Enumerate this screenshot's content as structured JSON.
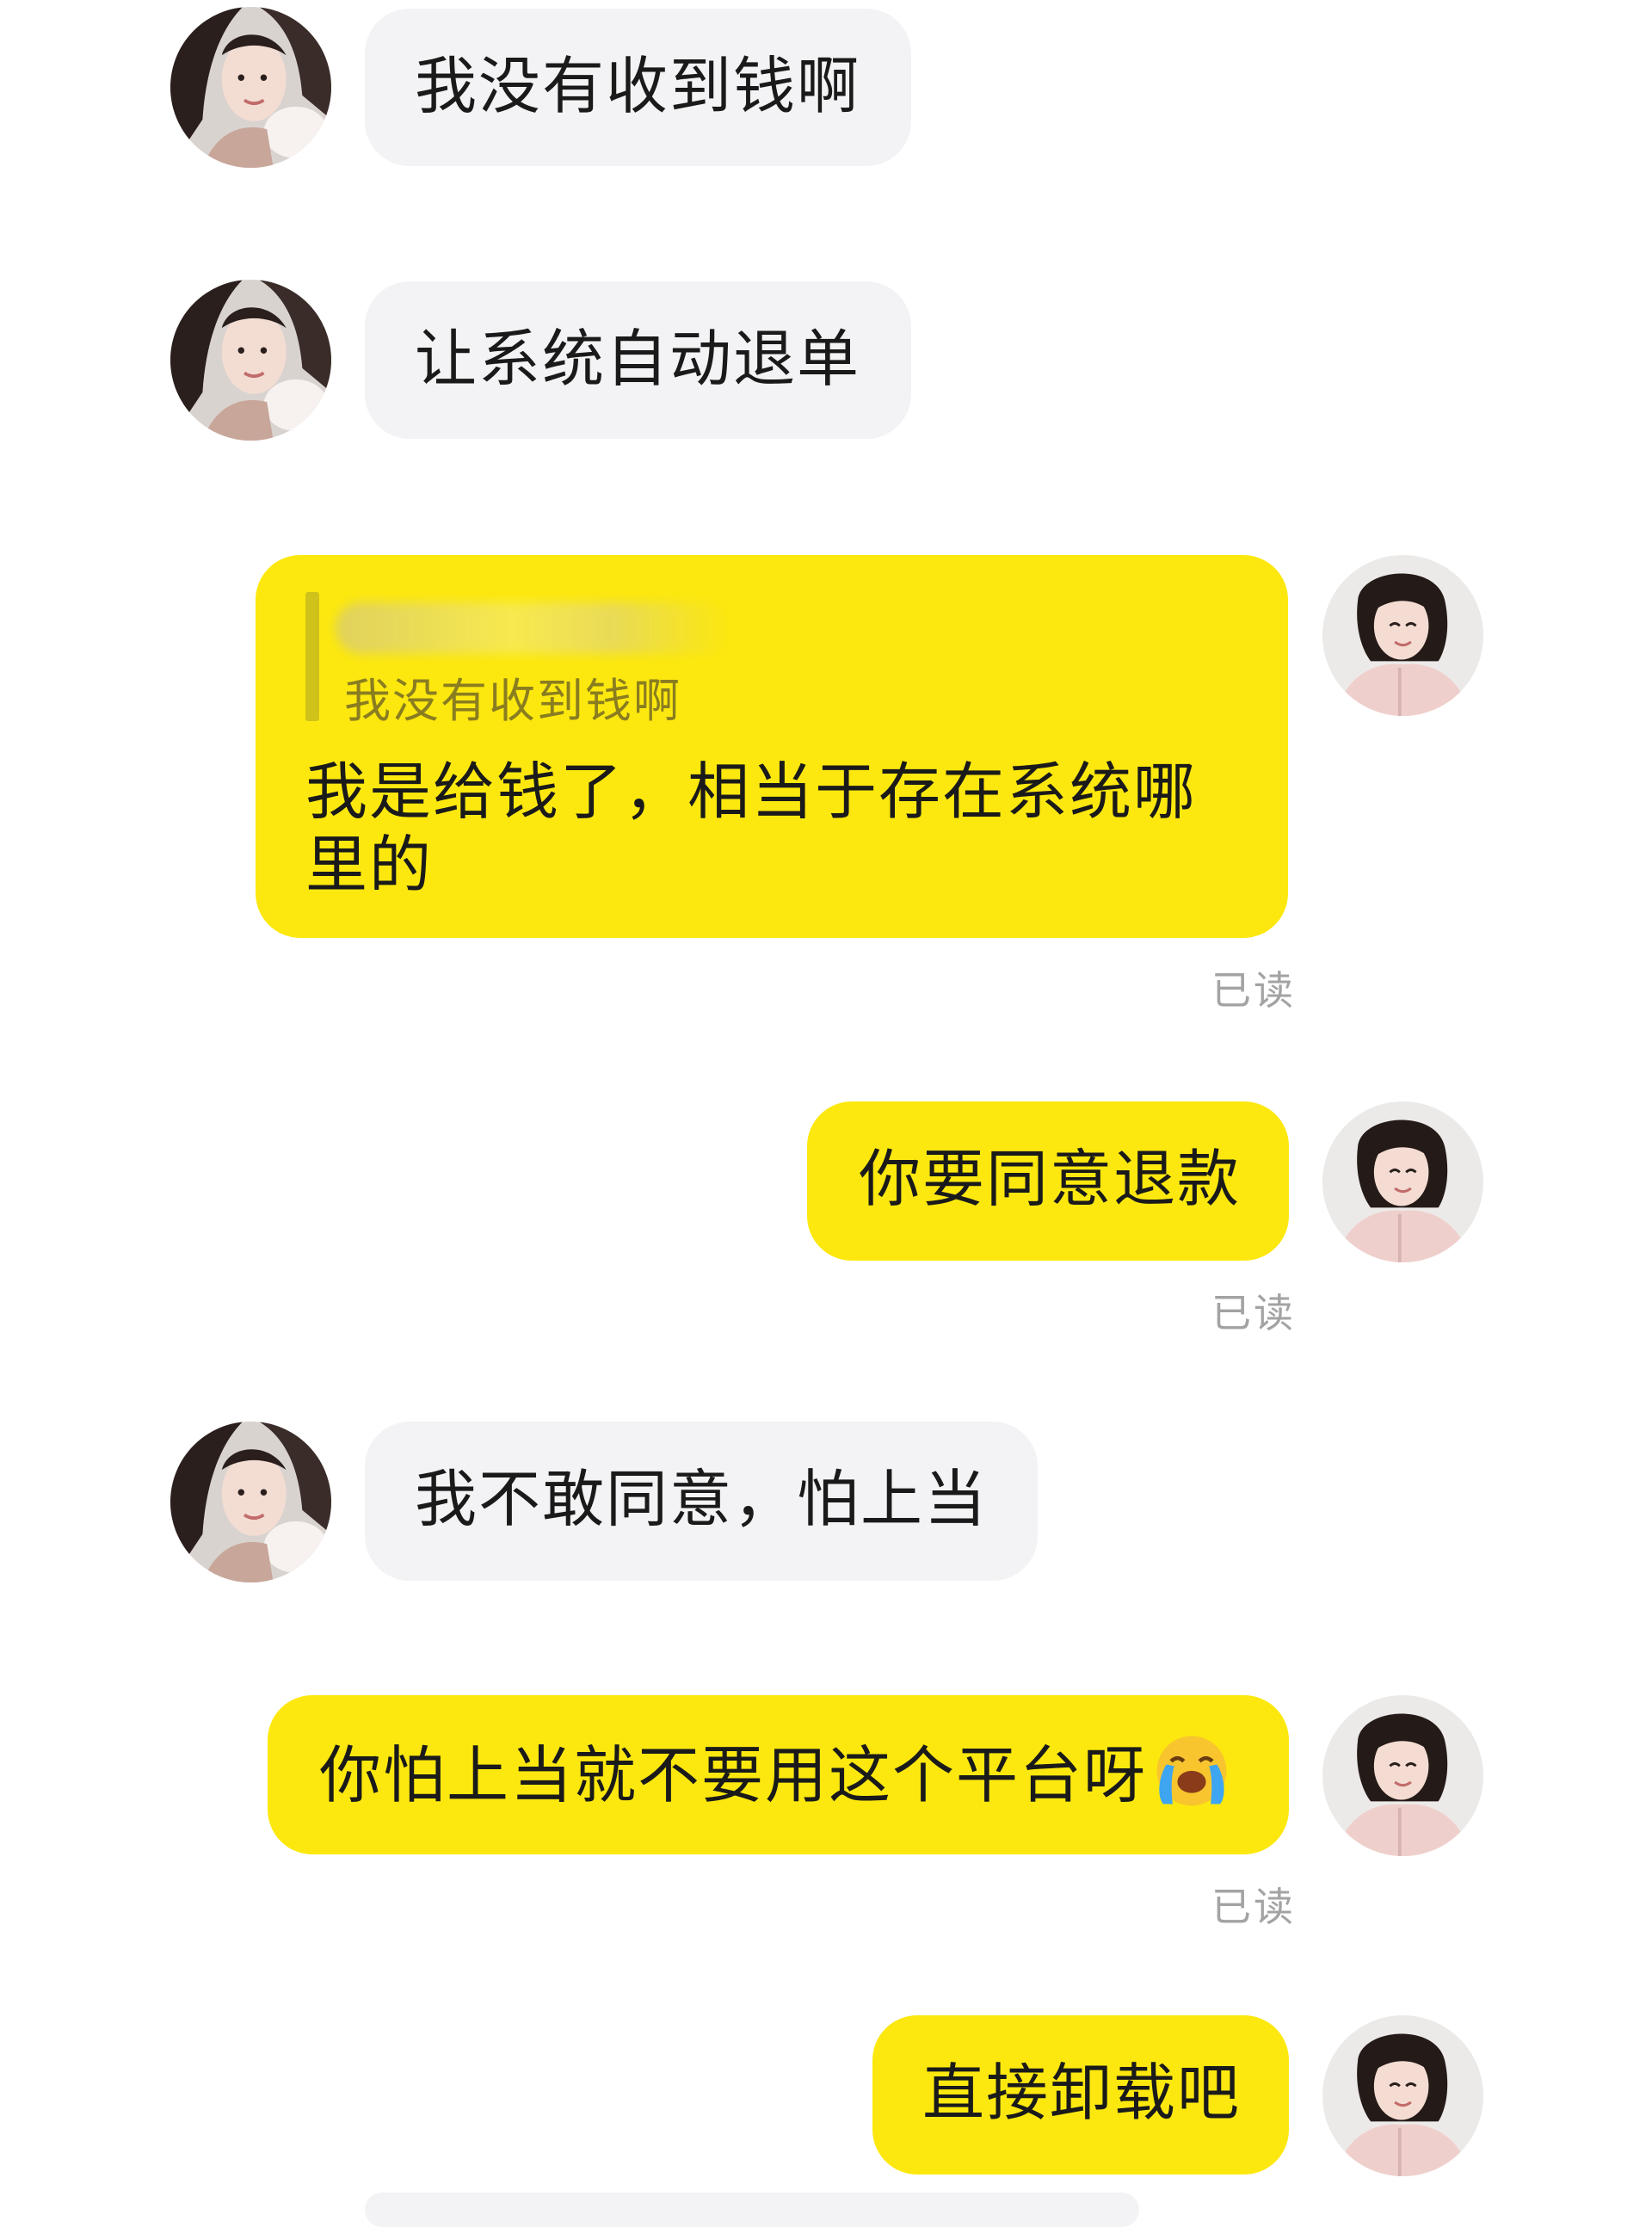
{
  "messages": [
    {
      "side": "in",
      "text": "我没有收到钱啊"
    },
    {
      "side": "in",
      "text": "让系统自动退单"
    },
    {
      "side": "out",
      "quote": "我没有收到钱啊",
      "line1": "我是给钱了，相当于存在系统哪",
      "line2": "里的",
      "status": "已读"
    },
    {
      "side": "out",
      "text": "你要同意退款",
      "status": "已读"
    },
    {
      "side": "in",
      "text": "我不敢同意，怕上当"
    },
    {
      "side": "out",
      "text": "你怕上当就不要用这个平台呀",
      "emoji": "loudly-crying-face",
      "status": "已读"
    },
    {
      "side": "out",
      "text": "直接卸载吧"
    }
  ],
  "colors": {
    "outgoing_bubble": "#fce80e",
    "incoming_bubble": "#f3f3f5",
    "read_status": "#a3a3a3"
  }
}
